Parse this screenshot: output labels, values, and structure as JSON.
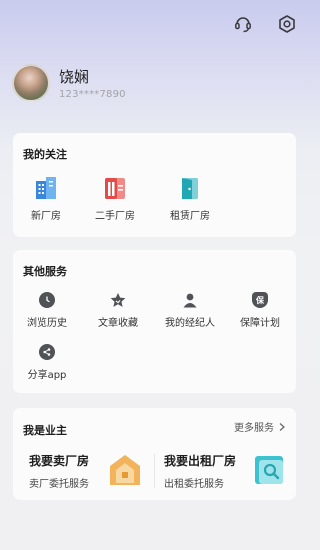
{
  "user": {
    "name": "饶娴",
    "phone": "123****7890"
  },
  "header": {
    "icons": [
      "headset-icon",
      "settings-icon"
    ]
  },
  "follow": {
    "title": "我的关注",
    "items": [
      {
        "label": "新厂房",
        "icon": "building-icon",
        "color": "#3a86d8"
      },
      {
        "label": "二手厂房",
        "icon": "factory-icon",
        "color": "#e24b47"
      },
      {
        "label": "租赁厂房",
        "icon": "door-icon",
        "color": "#21a7b3"
      }
    ]
  },
  "services": {
    "title": "其他服务",
    "items": [
      {
        "label": "浏览历史",
        "icon": "clock-icon"
      },
      {
        "label": "文章收藏",
        "icon": "star-icon"
      },
      {
        "label": "我的经纪人",
        "icon": "person-icon"
      },
      {
        "label": "保障计划",
        "icon": "shield-icon",
        "glyph": "保"
      },
      {
        "label": "分享app",
        "icon": "share-icon"
      }
    ]
  },
  "owner": {
    "title": "我是业主",
    "more_label": "更多服务",
    "sell": {
      "title": "我要卖厂房",
      "subtitle": "卖厂委托服务"
    },
    "rent": {
      "title": "我要出租厂房",
      "subtitle": "出租委托服务"
    }
  }
}
